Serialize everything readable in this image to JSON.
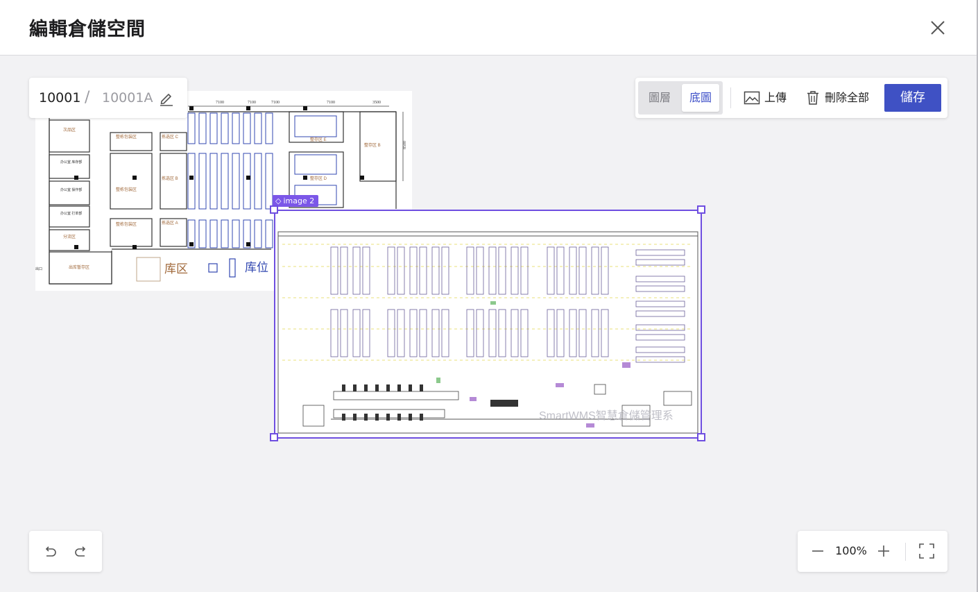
{
  "dialog": {
    "title": "編輯倉儲空間",
    "close_icon": "close-icon"
  },
  "breadcrumb": {
    "warehouse_id": "10001",
    "separator": "/",
    "space_id": "10001A",
    "edit_icon": "pencil-icon"
  },
  "toolbar": {
    "layers_label": "圖層",
    "base_map_label": "底圖",
    "base_map_active": true,
    "upload_label": "上傳",
    "delete_all_label": "刪除全部",
    "save_label": "儲存",
    "accent_color": "#3f51c4"
  },
  "canvas": {
    "image1": {
      "kind": "warehouse floor plan drawing",
      "zone_labels": [
        "次品区",
        "整栋包装区",
        "拣选区 C",
        "拣选区 B",
        "拣选区 A",
        "整存区 E",
        "整存区 D",
        "整存区 B",
        "办公室 库存部",
        "办公室 操作部",
        "办公室 打单部",
        "分流区",
        "出库暂存区",
        "出口"
      ],
      "dimension_labels": [
        "7100",
        "7100",
        "7100",
        "7100",
        "3500",
        "8500"
      ],
      "legend": [
        {
          "label": "库区"
        },
        {
          "label": "库位"
        }
      ]
    },
    "image2": {
      "tag_label": "image 2",
      "selected": true,
      "selection_color": "#6e4ee0",
      "watermark": "SmartWMS智慧倉儲管理系"
    }
  },
  "history": {
    "undo_icon": "undo-icon",
    "redo_icon": "redo-icon"
  },
  "zoom": {
    "level": "100%",
    "zoom_out_icon": "minus-icon",
    "zoom_in_icon": "plus-icon",
    "fullscreen_icon": "fullscreen-icon"
  }
}
